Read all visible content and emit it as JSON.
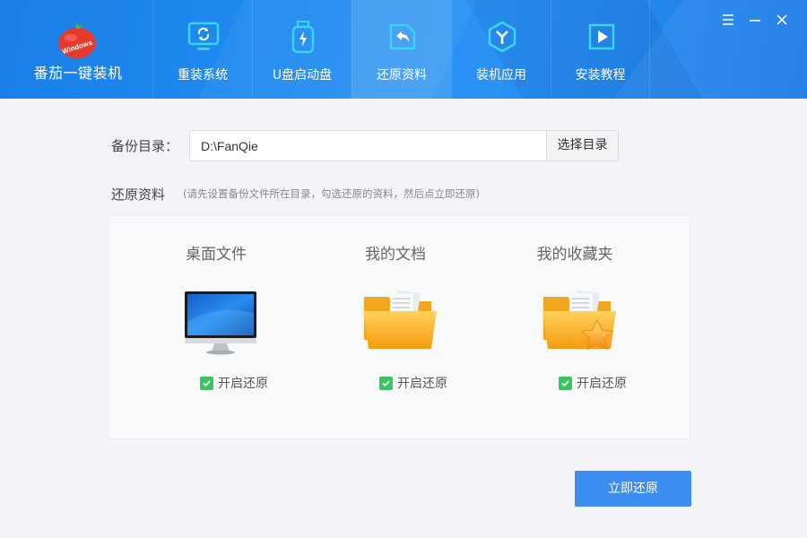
{
  "app": {
    "title": "番茄一键装机",
    "logo_text": "Windows"
  },
  "nav": [
    {
      "label": "重装系统",
      "icon": "monitor-refresh-icon"
    },
    {
      "label": "U盘启动盘",
      "icon": "usb-drive-icon"
    },
    {
      "label": "还原资料",
      "icon": "restore-file-icon",
      "active": true
    },
    {
      "label": "装机应用",
      "icon": "app-hexagon-icon"
    },
    {
      "label": "安装教程",
      "icon": "video-tutorial-icon"
    }
  ],
  "window_controls": [
    "menu-icon",
    "minimize-icon",
    "close-icon"
  ],
  "backup": {
    "label": "备份目录：",
    "path": "D:\\FanQie",
    "choose_button": "选择目录"
  },
  "restore": {
    "title": "还原资料",
    "hint": "(请先设置备份文件所在目录，勾选还原的资料，然后点立即还原)"
  },
  "cards": [
    {
      "title": "桌面文件",
      "icon": "desktop-computer-icon",
      "check_label": "开启还原",
      "checked": true
    },
    {
      "title": "我的文档",
      "icon": "folder-icon",
      "check_label": "开启还原",
      "checked": true
    },
    {
      "title": "我的收藏夹",
      "icon": "favorites-folder-icon",
      "check_label": "开启还原",
      "checked": true
    }
  ],
  "actions": {
    "restore_now": "立即还原"
  },
  "colors": {
    "header": "#1f8bf0",
    "nav_icon": "#39d4f7",
    "primary": "#3b8ef0",
    "check": "#3cc163"
  }
}
